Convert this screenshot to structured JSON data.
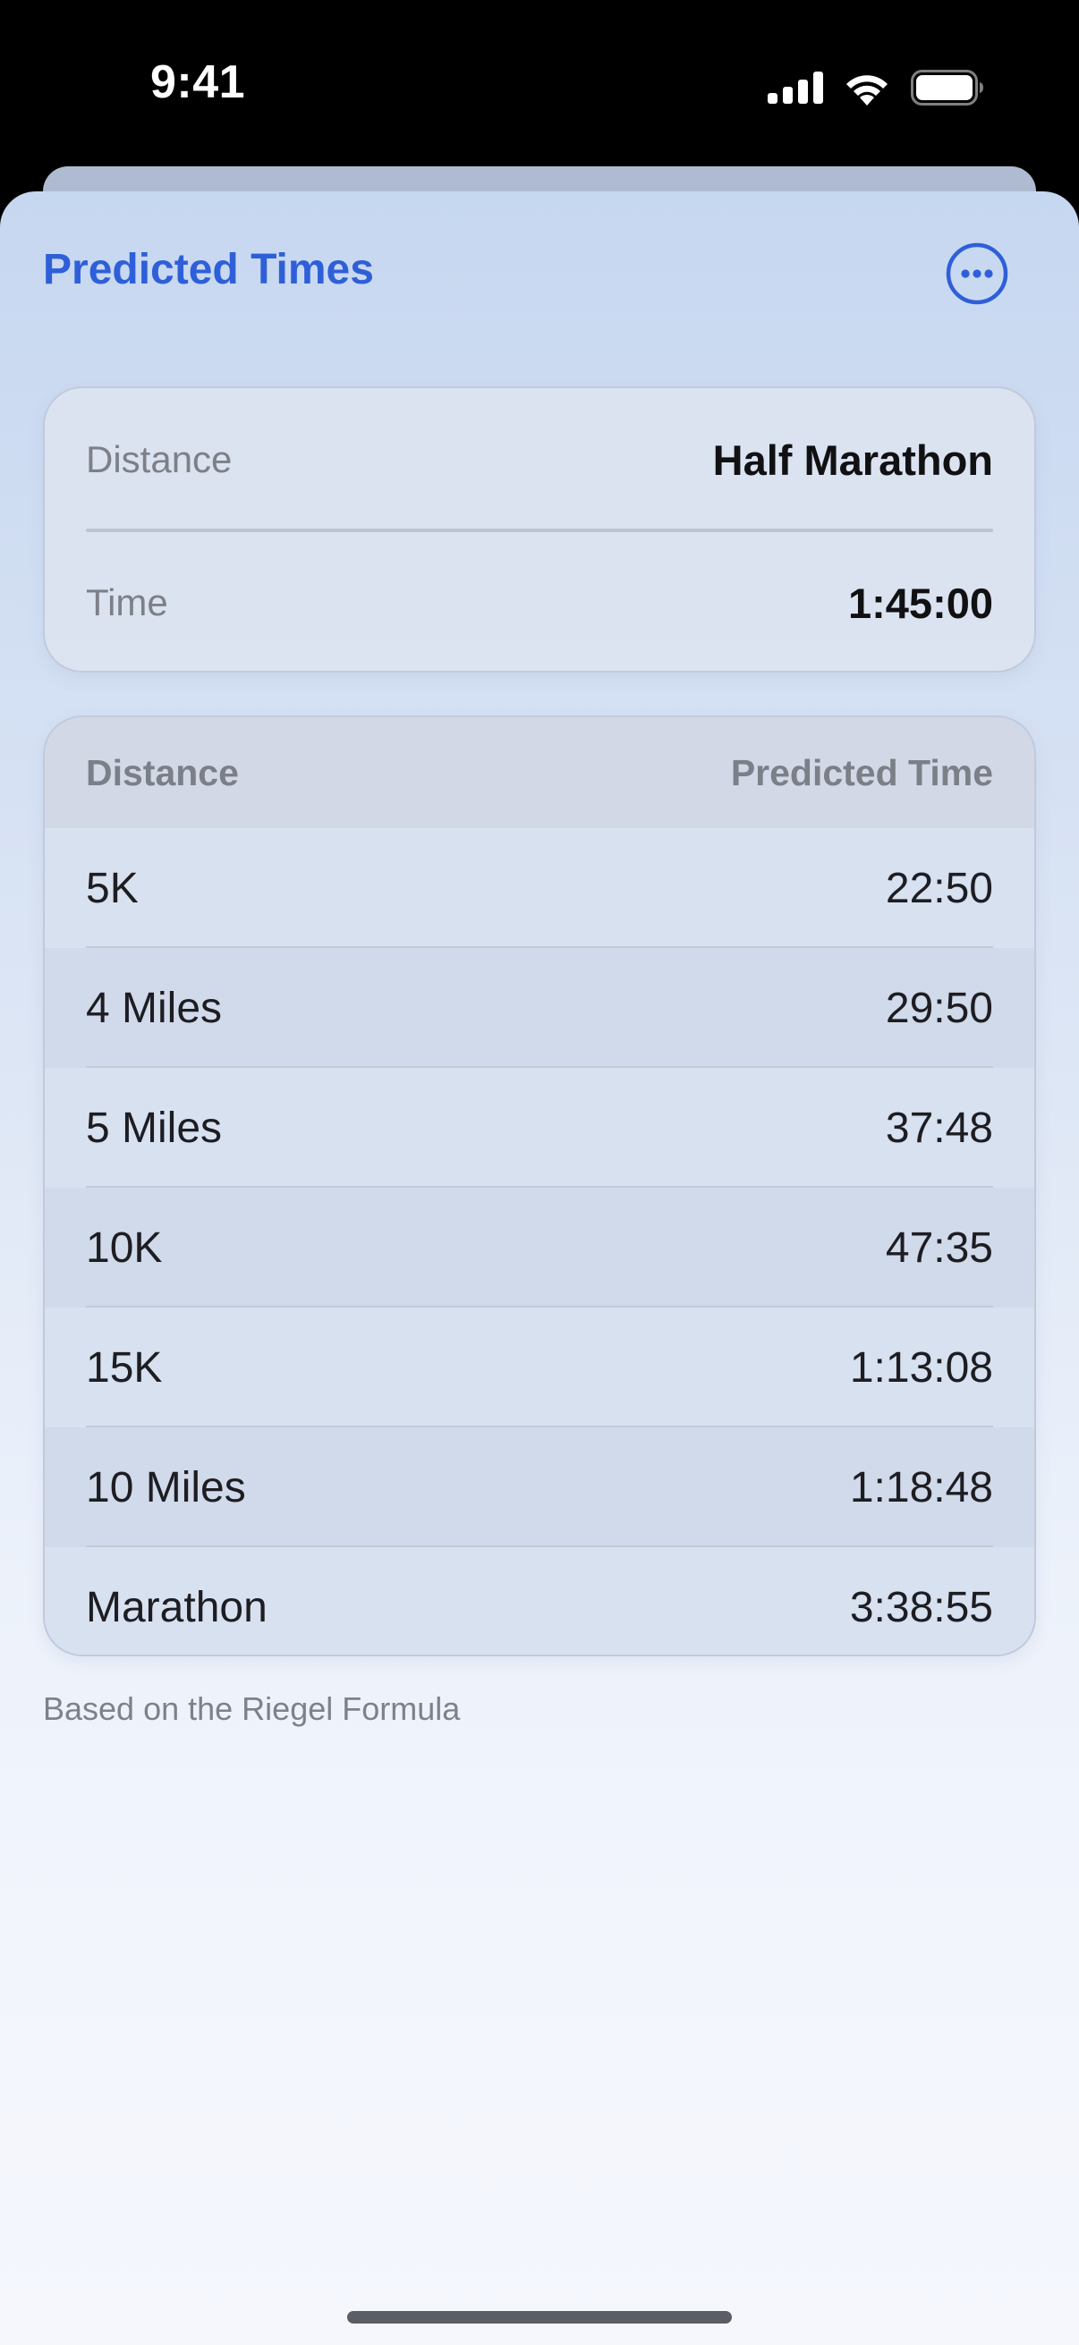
{
  "status_bar": {
    "time": "9:41"
  },
  "header": {
    "title": "Predicted Times",
    "more_icon": "ellipsis-circle-icon"
  },
  "input": {
    "distance_label": "Distance",
    "distance_value": "Half Marathon",
    "time_label": "Time",
    "time_value": "1:45:00"
  },
  "table": {
    "headers": [
      "Distance",
      "Predicted Time"
    ],
    "rows": [
      {
        "distance": "5K",
        "time": "22:50"
      },
      {
        "distance": "4 Miles",
        "time": "29:50"
      },
      {
        "distance": "5 Miles",
        "time": "37:48"
      },
      {
        "distance": "10K",
        "time": "47:35"
      },
      {
        "distance": "15K",
        "time": "1:13:08"
      },
      {
        "distance": "10 Miles",
        "time": "1:18:48"
      },
      {
        "distance": "Marathon",
        "time": "3:38:55"
      }
    ]
  },
  "footnote": "Based on the Riegel Formula",
  "colors": {
    "accent": "#2f5fd8"
  }
}
